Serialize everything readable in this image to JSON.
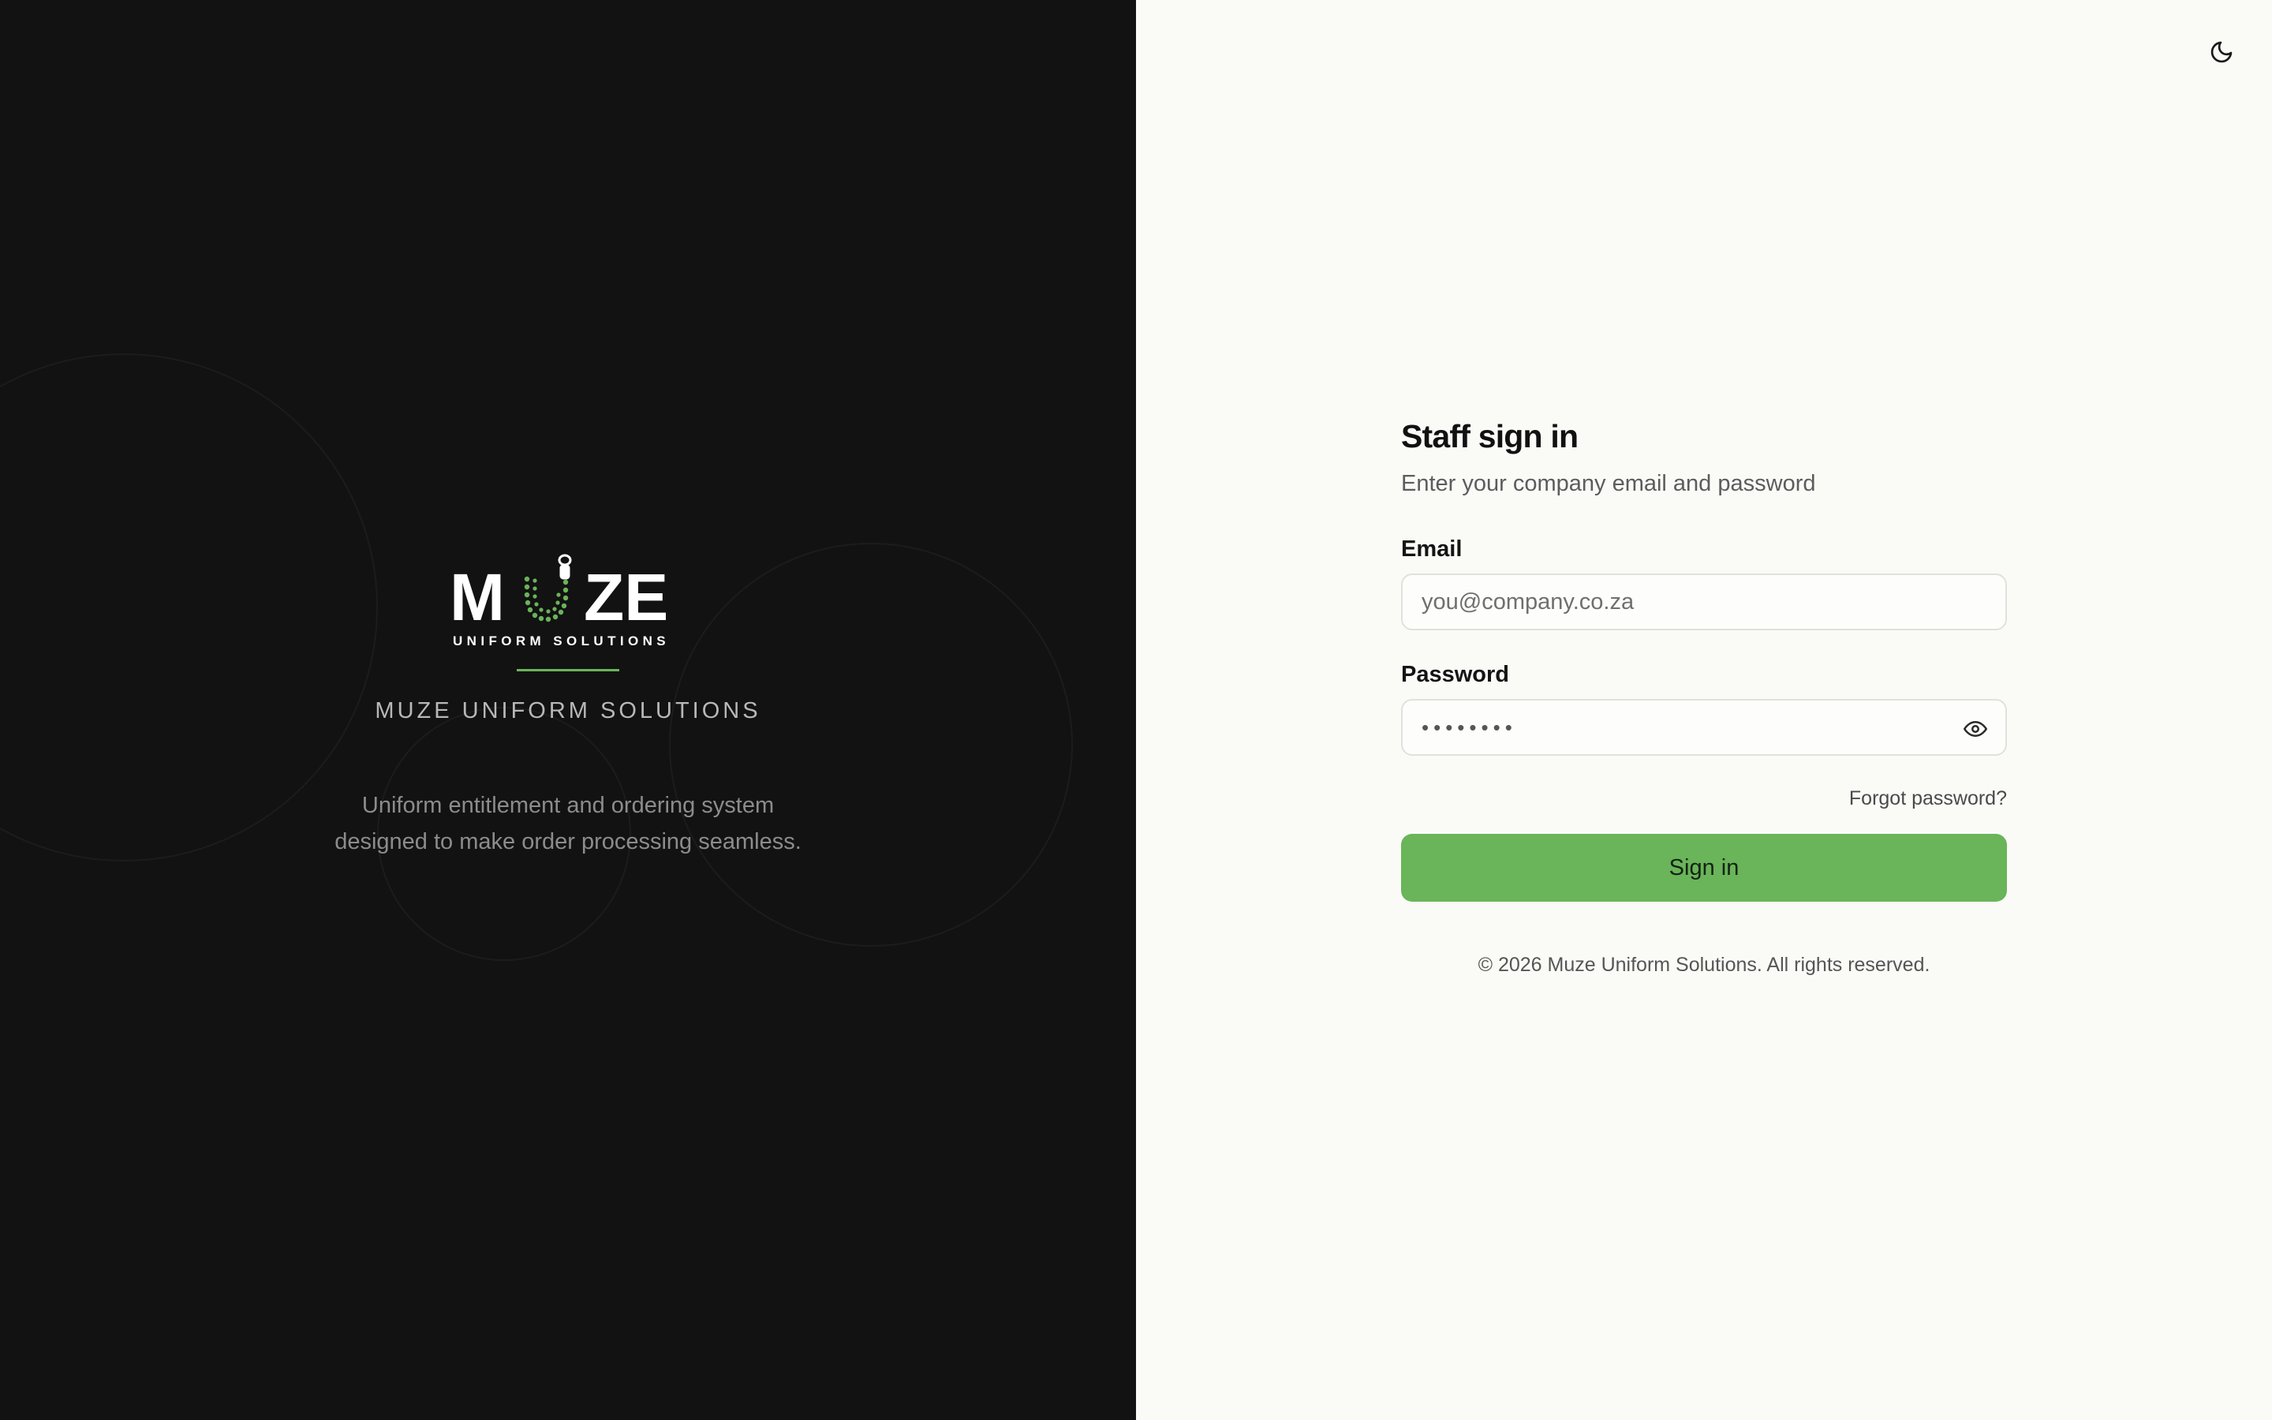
{
  "brand": {
    "logo_word_left": "M",
    "logo_word_right": "ZE",
    "logo_sub": "UNIFORM SOLUTIONS",
    "name": "MUZE UNIFORM SOLUTIONS",
    "tagline_line1": "Uniform entitlement and ordering system",
    "tagline_line2": "designed to make order processing seamless."
  },
  "theme_toggle": {
    "icon": "moon-icon"
  },
  "form": {
    "title": "Staff sign in",
    "subtitle": "Enter your company email and password",
    "email_label": "Email",
    "email_placeholder": "you@company.co.za",
    "email_value": "",
    "password_label": "Password",
    "password_value": "••••••••",
    "forgot_label": "Forgot password?",
    "submit_label": "Sign in"
  },
  "footer": {
    "copyright": "© 2026 Muze Uniform Solutions. All rights reserved."
  },
  "colors": {
    "accent": "#6ab45a",
    "dark_panel": "#121212",
    "light_panel": "#fafaf7"
  }
}
